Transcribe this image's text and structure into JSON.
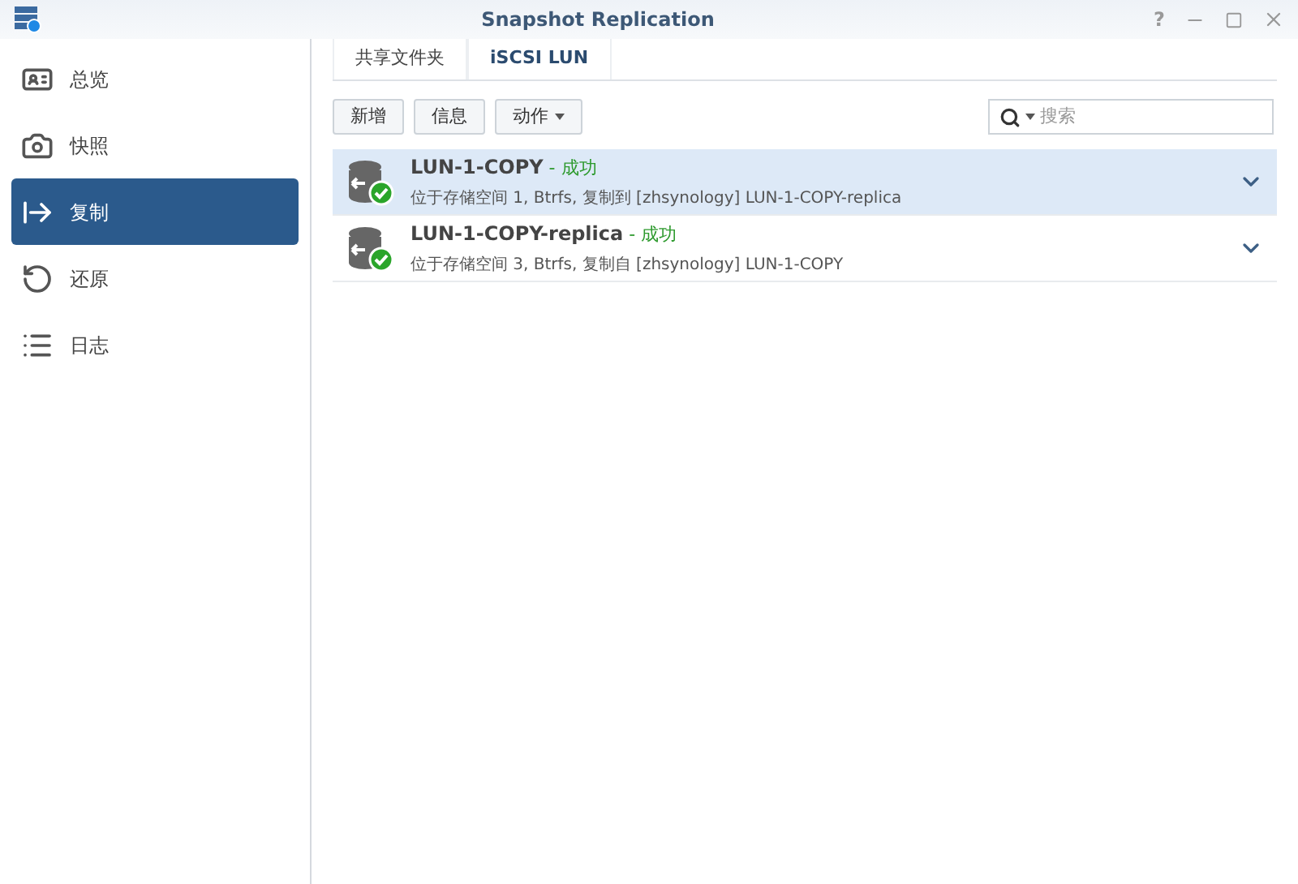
{
  "window": {
    "title": "Snapshot Replication",
    "help": "?"
  },
  "sidebar": {
    "items": [
      {
        "label": "总览",
        "kind": "overview",
        "selected": false
      },
      {
        "label": "快照",
        "kind": "snapshot",
        "selected": false
      },
      {
        "label": "复制",
        "kind": "replication",
        "selected": true
      },
      {
        "label": "还原",
        "kind": "restore",
        "selected": false
      },
      {
        "label": "日志",
        "kind": "log",
        "selected": false
      }
    ]
  },
  "tabs": [
    {
      "label": "共享文件夹",
      "selected": false
    },
    {
      "label": "iSCSI LUN",
      "selected": true
    }
  ],
  "toolbar": {
    "buttons": [
      {
        "label": "新增",
        "dropdown": false
      },
      {
        "label": "信息",
        "dropdown": false
      },
      {
        "label": "动作",
        "dropdown": true
      }
    ]
  },
  "search": {
    "placeholder": "搜索"
  },
  "rows": [
    {
      "name": "LUN-1-COPY",
      "status": " - 成功",
      "detail": "位于存储空间 1, Btrfs, 复制到 [zhsynology] LUN-1-COPY-replica",
      "selected": true
    },
    {
      "name": "LUN-1-COPY-replica",
      "status": " - 成功",
      "detail": "位于存储空间 3, Btrfs, 复制自 [zhsynology] LUN-1-COPY",
      "selected": false
    }
  ]
}
